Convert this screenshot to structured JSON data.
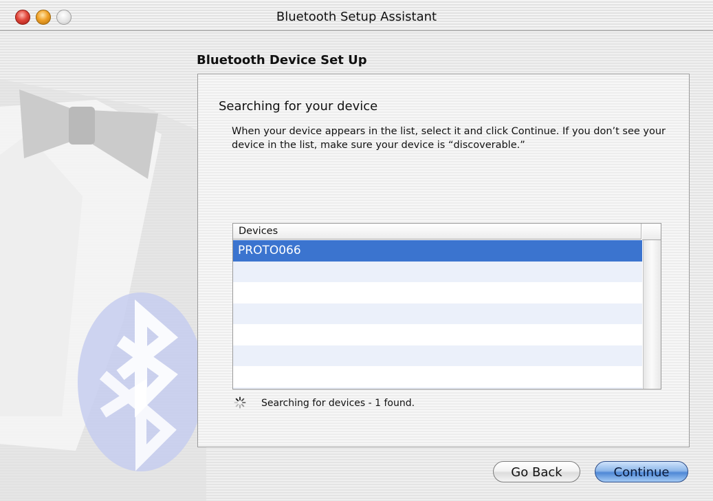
{
  "window": {
    "title": "Bluetooth Setup Assistant"
  },
  "header": {
    "section_title": "Bluetooth Device Set Up"
  },
  "panel": {
    "heading": "Searching for your device",
    "description": "When your device appears in the list, select it and click Continue. If you don’t see your device in the list, make sure your device is “discoverable.”"
  },
  "device_list": {
    "column_header": "Devices",
    "items": [
      "PROTO066"
    ],
    "selected_index": 0
  },
  "status": {
    "text": "Searching for devices - 1 found."
  },
  "buttons": {
    "go_back": "Go Back",
    "continue": "Continue"
  },
  "colors": {
    "selection": "#3b74cf",
    "alt_row": "#ebf0fa",
    "continue_button": "#4f88d6"
  },
  "icons": [
    "close-icon",
    "minimize-icon",
    "zoom-icon",
    "spinner-icon",
    "bluetooth-logo"
  ]
}
